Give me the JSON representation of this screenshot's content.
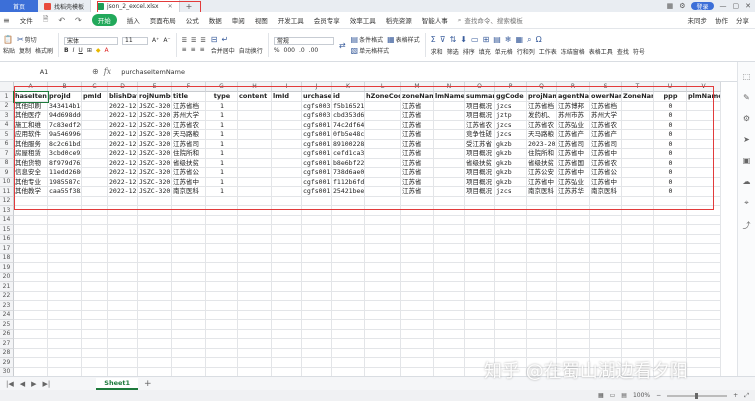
{
  "titlebar": {
    "home_tab": "首页",
    "tabs": [
      {
        "label": "找稻壳模板",
        "active": false
      },
      {
        "label": "json_2_excel.xlsx",
        "active": true
      }
    ],
    "new_tab_symbol": "+",
    "login_label": "登录"
  },
  "menubar": {
    "items": [
      "文件",
      "开始",
      "插入",
      "页面布局",
      "公式",
      "数据",
      "审阅",
      "视图",
      "开发工具",
      "会员专享",
      "效率工具",
      "稻壳资源",
      "智能人事"
    ],
    "active": "开始",
    "search_placeholder": "查找命令、搜索模板",
    "right_items": [
      "未同步",
      "协作",
      "分享"
    ]
  },
  "ribbon": {
    "paste": "粘贴",
    "cut": "剪切",
    "copy": "复制",
    "format_painter": "格式刷",
    "font_name": "宋体",
    "font_size": "11",
    "bold": "B",
    "italic": "I",
    "underline": "U",
    "merge_center": "合并居中",
    "wrap": "自动换行",
    "number_format": "常规",
    "cond_format": "条件格式",
    "cell_style": "单元格样式",
    "table_style": "表格样式",
    "sum": "求和",
    "filter": "筛选",
    "sort": "排序",
    "fill": "填充",
    "cell": "单元格",
    "row_col": "行和列",
    "worksheet": "工作表",
    "freeze": "冻结窗格",
    "table_tools": "表格工具",
    "find": "查找",
    "symbol": "符号"
  },
  "formula": {
    "name_box": "A1",
    "fx_label": "fx",
    "value": "purchaseItemName"
  },
  "columns": [
    "A",
    "B",
    "C",
    "D",
    "E",
    "F",
    "G",
    "H",
    "I",
    "J",
    "K",
    "L",
    "M",
    "N",
    "O",
    "P",
    "Q",
    "R",
    "S",
    "T",
    "U",
    "V"
  ],
  "rows": [
    "1",
    "2",
    "3",
    "4",
    "5",
    "6",
    "7",
    "8",
    "9",
    "10",
    "11",
    "12",
    "13",
    "14",
    "15",
    "16",
    "17",
    "18",
    "19",
    "20",
    "21",
    "22",
    "23",
    "24",
    "25",
    "26",
    "27",
    "28",
    "29",
    "30",
    "31"
  ],
  "header_row": [
    "haseIten",
    "projId",
    "pmId",
    "blishDate",
    "rojNumbe",
    "title",
    "type",
    "content",
    "lmId",
    "urchaseW",
    "id",
    "hZoneCode",
    "zoneName",
    "lmName",
    "summary",
    "ggCode",
    "projName",
    "agentName",
    "owerName",
    "ZoneName",
    "ppp",
    "plmName"
  ],
  "data_rows": [
    [
      "其他印刷",
      "343414b1c",
      "",
      "2022-12-",
      "JSZC-320(",
      "江苏省档",
      "1",
      "",
      "",
      "cgfs003",
      "f5b16521",
      "",
      "江苏省",
      "",
      "项目概况",
      "jzcs",
      "江苏省档",
      "江苏博邦",
      "江苏省档",
      "",
      "0",
      ""
    ],
    [
      "其他医疗",
      "94d698dd6",
      "",
      "2022-12-",
      "JSZC-320(",
      "苏州大学",
      "1",
      "",
      "",
      "cgfs003",
      "cbd353d6",
      "",
      "江苏省",
      "",
      "项目概况",
      "jztp",
      "发药机、",
      "苏州市苏",
      "苏州大学",
      "",
      "0",
      ""
    ],
    [
      "施工和维",
      "7c83edf20",
      "",
      "2022-12-",
      "JSZC-320(",
      "江苏省农",
      "1",
      "",
      "",
      "cgfs001",
      "74c2df64",
      "",
      "江苏省",
      "",
      "江苏省农",
      "jzcs",
      "江苏省农",
      "江苏弘业",
      "江苏省农",
      "",
      "0",
      ""
    ],
    [
      "应用软件",
      "9a546996e",
      "",
      "2022-12-",
      "JSZC-320(",
      "天马路粮",
      "1",
      "",
      "",
      "cgfs001",
      "0fb5e48c",
      "",
      "江苏省",
      "",
      "竞争性磋",
      "jzcs",
      "天马路粮",
      "江苏省产",
      "江苏省产",
      "",
      "0",
      ""
    ],
    [
      "其他服务",
      "8c2c61bd2",
      "",
      "2022-12-",
      "JSZC-320(",
      "江苏省司",
      "1",
      "",
      "",
      "cgfs001",
      "891002281",
      "",
      "江苏省",
      "",
      "受江苏省",
      "gkzb",
      "2023-202",
      "江苏省司",
      "江苏省司",
      "",
      "0",
      ""
    ],
    [
      "房屋租赁",
      "3cbd0ce93",
      "",
      "2022-12-",
      "JSZC-320(",
      "住院所和",
      "1",
      "",
      "",
      "cgfs001",
      "cefd1ca3",
      "",
      "江苏省",
      "",
      "项目概况",
      "gkzb",
      "住院所和",
      "江苏省中",
      "江苏省中",
      "",
      "0",
      ""
    ],
    [
      "其他货物",
      "8f979d762",
      "",
      "2022-12-",
      "JSZC-320(",
      "省级扶贫",
      "1",
      "",
      "",
      "cgfs001",
      "b8e6bf22",
      "",
      "江苏省",
      "",
      "省级扶贫",
      "gkzb",
      "省级扶贫",
      "江苏省国",
      "江苏省农",
      "",
      "0",
      ""
    ],
    [
      "信息安全",
      "11edd2686",
      "",
      "2022-12-",
      "JSZC-320(",
      "江苏省公",
      "1",
      "",
      "",
      "cgfs001",
      "738d6ae0",
      "",
      "江苏省",
      "",
      "项目概况",
      "gkzb",
      "江苏公安",
      "江苏省中",
      "江苏省公",
      "",
      "0",
      ""
    ],
    [
      "其他专业",
      "1985587c1",
      "",
      "2022-12-",
      "JSZC-320(",
      "江苏省中",
      "1",
      "",
      "",
      "cgfs001",
      "f112b6fd",
      "",
      "江苏省",
      "",
      "项目概况",
      "gkzb",
      "江苏省中",
      "江苏弘业",
      "江苏省中",
      "",
      "0",
      ""
    ],
    [
      "其他教学",
      "caa55f383",
      "",
      "2022-12-",
      "JSZC-320(",
      "南京医科",
      "1",
      "",
      "",
      "cgfs001",
      "25421bee",
      "",
      "江苏省",
      "",
      "项目概况",
      "jzcs",
      "南京医科",
      "江苏苏华",
      "南京医科",
      "",
      "0",
      ""
    ]
  ],
  "sheet_tabs": [
    "Sheet1"
  ],
  "sheet_add": "+",
  "status": {
    "zoom": "100%"
  },
  "watermark": "知乎 @在蜀山湖边看夕阳"
}
